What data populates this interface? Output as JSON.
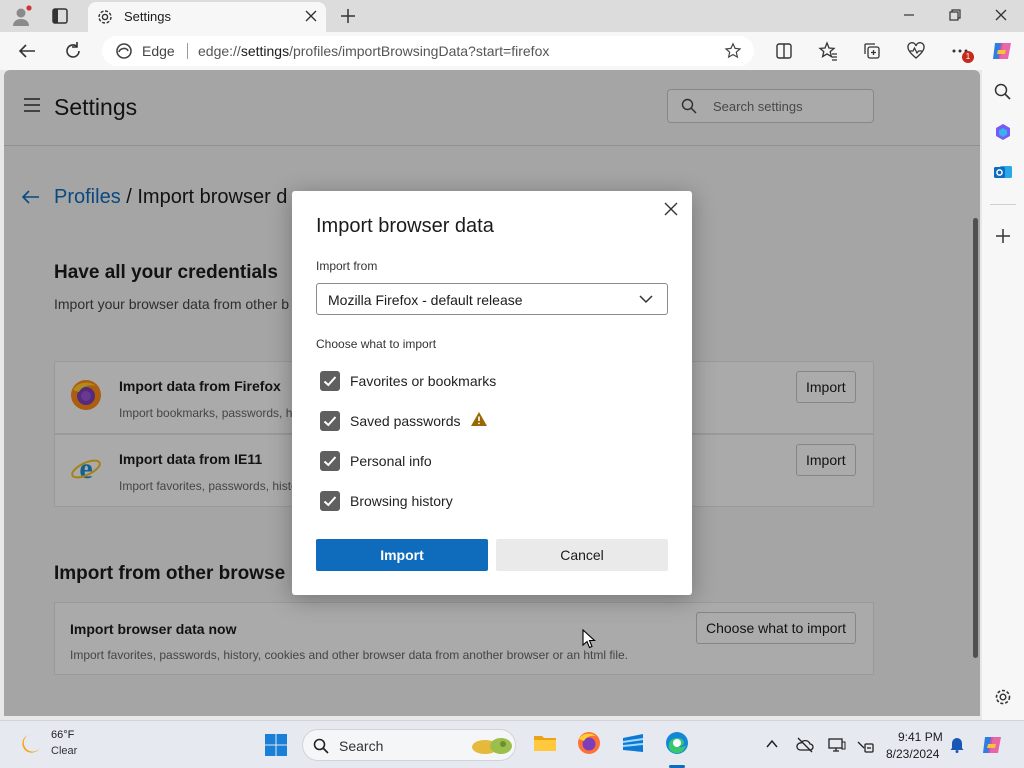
{
  "browser": {
    "tab_title": "Settings",
    "site_label": "Edge",
    "url_prefix": "edge://",
    "url_host": "settings",
    "url_path": "/profiles/importBrowsingData?start=firefox",
    "notification_count": "1",
    "accent": "#0f6cbd"
  },
  "settings": {
    "title": "Settings",
    "search_placeholder": "Search settings"
  },
  "breadcrumb": {
    "link": "Profiles",
    "current": "/ Import browser d"
  },
  "credentials": {
    "heading": "Have all your credentials",
    "subtext": "Import your browser data from other b"
  },
  "import_cards": [
    {
      "title": "Import data from Firefox",
      "subtitle": "Import bookmarks, passwords, hi",
      "button": "Import",
      "icon": "firefox-icon"
    },
    {
      "title": "Import data from IE11",
      "subtitle": "Import favorites, passwords, histo",
      "button": "Import",
      "icon": "ie11-icon"
    }
  ],
  "other": {
    "heading": "Import from other browse",
    "card_title": "Import browser data now",
    "card_subtitle": "Import favorites, passwords, history, cookies and other browser data from another browser or an html file.",
    "card_button": "Choose what to import"
  },
  "dialog": {
    "title": "Import browser data",
    "import_from_label": "Import from",
    "selected_browser": "Mozilla Firefox - default release",
    "choose_label": "Choose what to import",
    "options": [
      {
        "label": "Favorites or bookmarks",
        "checked": true
      },
      {
        "label": "Saved passwords",
        "checked": true
      },
      {
        "label": "Personal info",
        "checked": true
      },
      {
        "label": "Browsing history",
        "checked": true
      }
    ],
    "import_button": "Import",
    "cancel_button": "Cancel",
    "warning_icon": "warning-icon"
  },
  "taskbar": {
    "weather_temp": "66°F",
    "weather_condition": "Clear",
    "search_label": "Search",
    "time": "9:41 PM",
    "date": "8/23/2024"
  }
}
